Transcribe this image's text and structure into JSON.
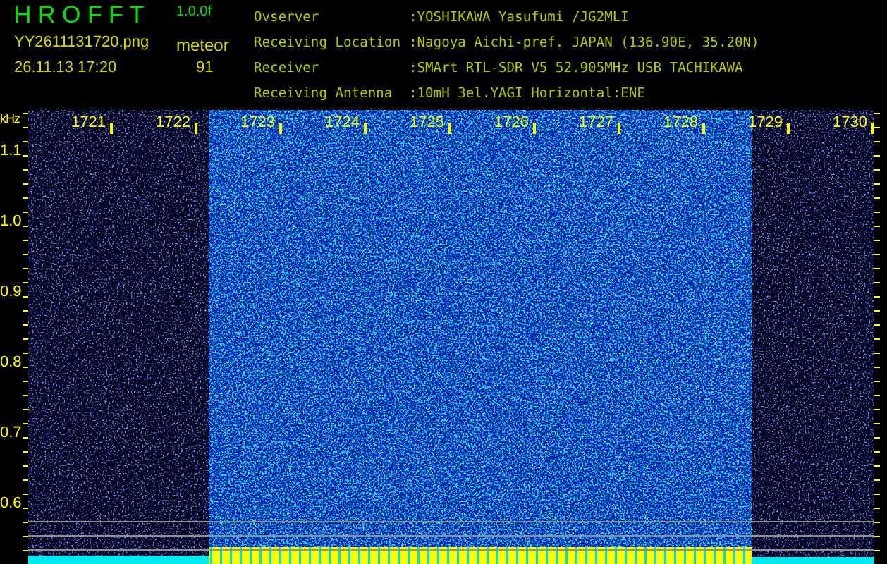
{
  "header": {
    "title": "H R O F F T",
    "version": "1.0.0f",
    "file": "YY2611131720.png",
    "event_type": "meteor",
    "datetime": "26.11.13 17:20",
    "count": "91"
  },
  "info": [
    {
      "label": "Ovserver",
      "value": ":YOSHIKAWA Yasufumi /JG2MLI"
    },
    {
      "label": "Receiving Location",
      "value": ":Nagoya Aichi-pref. JAPAN (136.90E, 35.20N)"
    },
    {
      "label": "Receiver",
      "value": ":SMArt RTL-SDR V5 52.905MHz USB TACHIKAWA"
    },
    {
      "label": "Receiving Antenna",
      "value": ":10mH 3el.YAGI Horizontal:ENE"
    }
  ],
  "spectrogram": {
    "y_unit": "kHz",
    "frequency_labels": [
      "1721",
      "1722",
      "1723",
      "1724",
      "1725",
      "1726",
      "1727",
      "1728",
      "1729",
      "1730"
    ],
    "y_labels": [
      "1.1",
      "1.0",
      "0.9",
      "0.8",
      "0.7",
      "0.6"
    ]
  }
}
